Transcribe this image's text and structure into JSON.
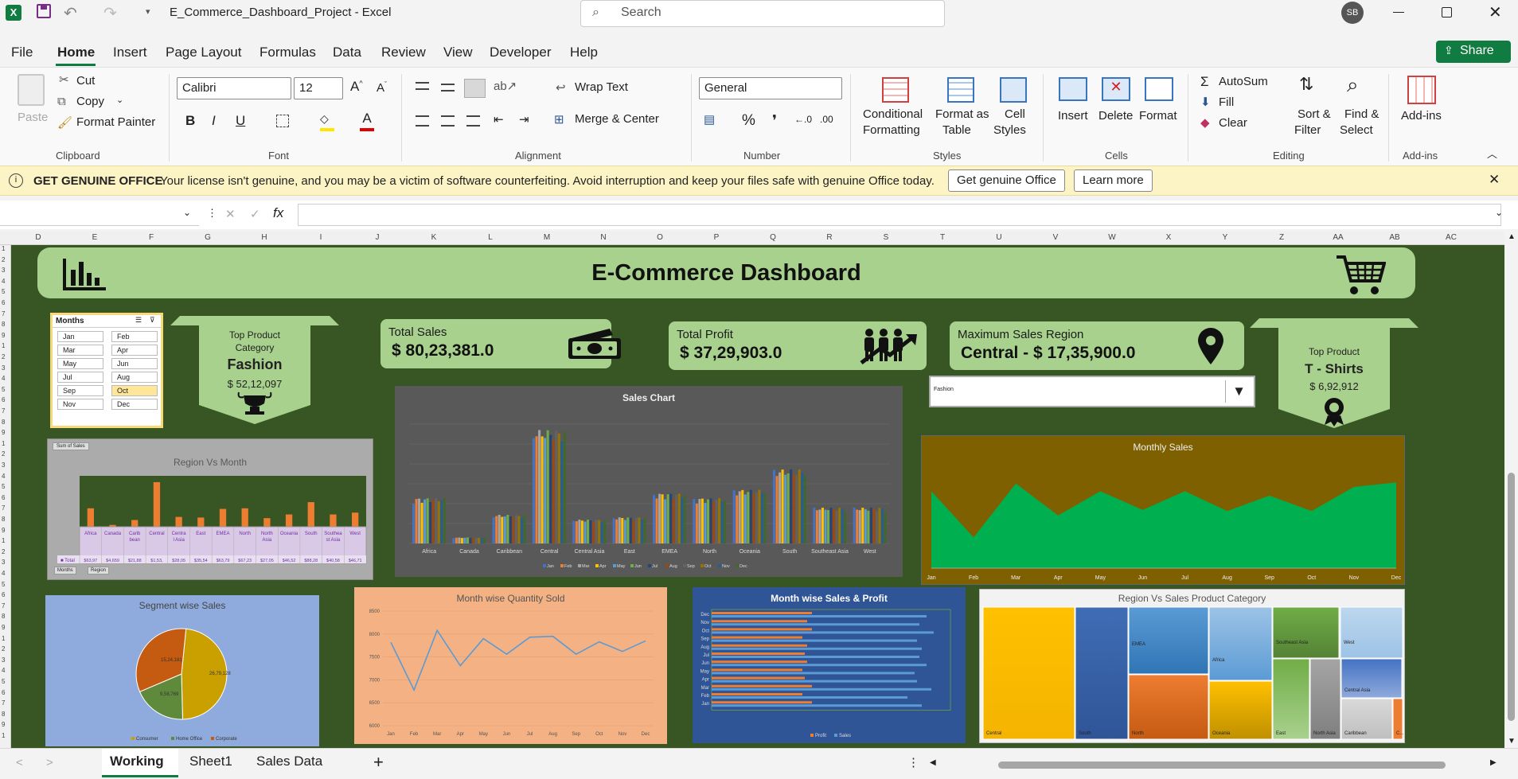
{
  "app": {
    "title": "E_Commerce_Dashboard_Project - Excel",
    "search_placeholder": "Search",
    "user_initials": "SB",
    "share_label": "Share"
  },
  "menu": [
    "File",
    "Home",
    "Insert",
    "Page Layout",
    "Formulas",
    "Data",
    "Review",
    "View",
    "Developer",
    "Help"
  ],
  "ribbon": {
    "clipboard": {
      "paste": "Paste",
      "cut": "Cut",
      "copy": "Copy",
      "format_painter": "Format Painter",
      "label": "Clipboard"
    },
    "font": {
      "name": "Calibri",
      "size": "12",
      "bold": "B",
      "italic": "I",
      "underline": "U",
      "label": "Font"
    },
    "alignment": {
      "wrap": "Wrap Text",
      "merge": "Merge & Center",
      "label": "Alignment"
    },
    "number": {
      "format": "General",
      "percent": "%",
      "comma": "❜",
      "label": "Number"
    },
    "styles": {
      "cond": "Conditional",
      "cond2": "Formatting",
      "fmt_table": "Format as",
      "fmt_table2": "Table",
      "cell_styles": "Cell",
      "cell_styles2": "Styles",
      "label": "Styles"
    },
    "cells": {
      "insert": "Insert",
      "delete": "Delete",
      "format": "Format",
      "label": "Cells"
    },
    "editing": {
      "autosum": "AutoSum",
      "fill": "Fill",
      "clear": "Clear",
      "sort": "Sort &",
      "sort2": "Filter",
      "find": "Find &",
      "find2": "Select",
      "label": "Editing"
    },
    "addins": {
      "addins": "Add-ins",
      "label": "Add-ins"
    }
  },
  "banner": {
    "title": "GET GENUINE OFFICE",
    "message": "Your license isn't genuine, and you may be a victim of software counterfeiting. Avoid interruption and keep your files safe with genuine Office today.",
    "btn1": "Get genuine Office",
    "btn2": "Learn more"
  },
  "formula": {
    "namebox": "",
    "fx": "fx"
  },
  "columns": [
    "D",
    "E",
    "F",
    "G",
    "H",
    "I",
    "J",
    "K",
    "L",
    "M",
    "N",
    "O",
    "P",
    "Q",
    "R",
    "S",
    "T",
    "U",
    "V",
    "W",
    "X",
    "Y",
    "Z",
    "AA",
    "AB",
    "AC"
  ],
  "dashboard": {
    "title": "E-Commerce Dashboard",
    "slicer": {
      "title": "Months",
      "items": [
        "Jan",
        "Feb",
        "Mar",
        "Apr",
        "May",
        "Jun",
        "Jul",
        "Aug",
        "Sep",
        "Oct",
        "Nov",
        "Dec"
      ],
      "selected": "Oct"
    },
    "top_category": {
      "label1": "Top Product",
      "label2": "Category",
      "name": "Fashion",
      "value": "$ 52,12,097"
    },
    "total_sales": {
      "title": "Total Sales",
      "value": "$ 80,23,381.0"
    },
    "total_profit": {
      "title": "Total Profit",
      "value": "$ 37,29,903.0"
    },
    "max_region": {
      "title": "Maximum Sales Region",
      "value": "Central -  $ 17,35,900.0"
    },
    "top_product": {
      "label": "Top Product",
      "name": "T - Shirts",
      "value": "$ 6,92,912"
    },
    "dropdown": {
      "value": "Fashion"
    }
  },
  "chart_data": [
    {
      "type": "bar",
      "title": "Region Vs Month",
      "field_button": "Sum of Sales",
      "categories": [
        "Africa",
        "Canada",
        "Caribbean",
        "Central",
        "Central Asia",
        "East",
        "EMEA",
        "North",
        "North Asia",
        "Oceania",
        "South",
        "Southeast Asia",
        "West"
      ],
      "totals_label": "Total",
      "values_text": [
        "$63,97",
        "$4,659",
        "$21,88",
        "$1,53,",
        "$28,05",
        "$35,54",
        "$63,79",
        "$67,23",
        "$27,05",
        "$46,52",
        "$88,28",
        "$40,58",
        "$46,71"
      ],
      "values": [
        60,
        6,
        22,
        145,
        32,
        30,
        58,
        60,
        28,
        40,
        80,
        40,
        46
      ],
      "buttons": [
        "Months",
        "Region"
      ]
    },
    {
      "type": "bar",
      "title": "Sales Chart",
      "categories": [
        "Africa",
        "Canada",
        "Caribbean",
        "Central",
        "Central Asia",
        "East",
        "EMEA",
        "North",
        "Oceania",
        "South",
        "Southeast Asia",
        "West"
      ],
      "series": [
        "Jan",
        "Feb",
        "Mar",
        "Apr",
        "May",
        "Jun",
        "Jul",
        "Aug",
        "Sep",
        "Oct",
        "Nov",
        "Dec"
      ],
      "heights": [
        0.38,
        0.05,
        0.24,
        0.95,
        0.2,
        0.22,
        0.42,
        0.38,
        0.45,
        0.62,
        0.3,
        0.3
      ]
    },
    {
      "type": "area",
      "title": "Monthly Sales",
      "categories": [
        "Jan",
        "Feb",
        "Mar",
        "Apr",
        "May",
        "Jun",
        "Jul",
        "Aug",
        "Sep",
        "Oct",
        "Nov",
        "Dec"
      ],
      "values": [
        0.7,
        0.28,
        0.77,
        0.48,
        0.7,
        0.53,
        0.7,
        0.52,
        0.66,
        0.52,
        0.74,
        0.78
      ]
    },
    {
      "type": "pie",
      "title": "Segment wise Sales",
      "slices": [
        {
          "name": "Consumer",
          "label": "26,79,128",
          "value": 48,
          "color": "#c9a000"
        },
        {
          "name": "Home Office",
          "label": "9,58,769",
          "value": 19,
          "color": "#5f8a3b"
        },
        {
          "name": "Corporate",
          "label": "15,24,181",
          "value": 33,
          "color": "#c55a11"
        }
      ]
    },
    {
      "type": "line",
      "title": "Month wise Quantity Sold",
      "y_ticks": [
        "8500",
        "8000",
        "7500",
        "7000",
        "6500",
        "6000"
      ],
      "ylim": [
        6000,
        8500
      ],
      "categories": [
        "Jan",
        "Feb",
        "Mar",
        "Apr",
        "May",
        "Jun",
        "Jul",
        "Aug",
        "Sep",
        "Oct",
        "Nov",
        "Dec"
      ],
      "values": [
        7820,
        6780,
        8080,
        7310,
        7900,
        7560,
        7930,
        7950,
        7560,
        7830,
        7620,
        7850
      ]
    },
    {
      "type": "bar",
      "title": "Month wise Sales & Profit",
      "categories": [
        "Dec",
        "Nov",
        "Oct",
        "Sep",
        "Aug",
        "Jul",
        "Jun",
        "May",
        "Apr",
        "Mar",
        "Feb",
        "Jan"
      ],
      "series": [
        {
          "name": "Profit",
          "values": [
            0.42,
            0.4,
            0.42,
            0.38,
            0.4,
            0.39,
            0.4,
            0.38,
            0.39,
            0.42,
            0.38,
            0.42
          ]
        },
        {
          "name": "Sales",
          "values": [
            0.9,
            0.87,
            0.93,
            0.86,
            0.88,
            0.87,
            0.9,
            0.85,
            0.86,
            0.92,
            0.82,
            0.88
          ]
        }
      ]
    },
    {
      "type": "heatmap",
      "title": "Region Vs Sales Product Category",
      "cells": [
        "Central",
        "South",
        "EMEA",
        "North",
        "Africa",
        "Oceania",
        "Southeast Asia",
        "East",
        "North Asia",
        "West",
        "Central Asia",
        "Caribbean",
        "C..."
      ]
    }
  ],
  "sheets": [
    "Working",
    "Sheet1",
    "Sales Data"
  ],
  "active_sheet": "Working"
}
